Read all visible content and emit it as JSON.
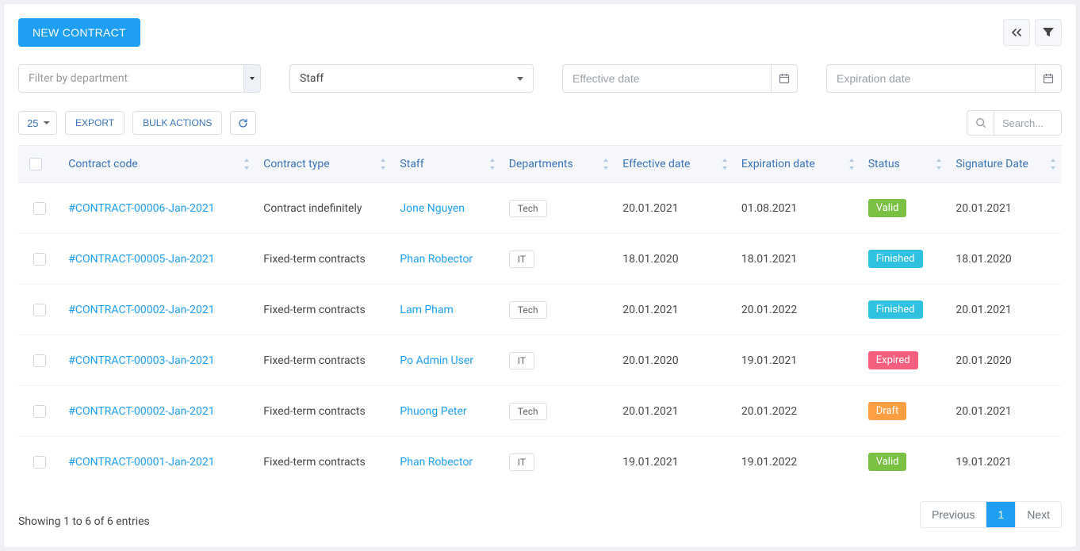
{
  "colors": {
    "primary": "#1e9ff2",
    "valid": "#7ac143",
    "finished": "#2fc1e0",
    "expired": "#f65f7e",
    "draft": "#ff9f43"
  },
  "topbar": {
    "new_contract_label": "NEW CONTRACT"
  },
  "filters": {
    "department_placeholder": "Filter by department",
    "staff_label": "Staff",
    "effective_placeholder": "Effective date",
    "expiration_placeholder": "Expiration date"
  },
  "toolbar": {
    "page_size": "25",
    "export_label": "EXPORT",
    "bulk_actions_label": "BULK ACTIONS",
    "search_placeholder": "Search..."
  },
  "table": {
    "headers": {
      "code": "Contract code",
      "type": "Contract type",
      "staff": "Staff",
      "dept": "Departments",
      "effective": "Effective date",
      "expiration": "Expiration date",
      "status": "Status",
      "signature": "Signature Date"
    },
    "rows": [
      {
        "code": "#CONTRACT-00006-Jan-2021",
        "type": "Contract indefinitely",
        "staff": "Jone Nguyen",
        "dept": "Tech",
        "effective": "20.01.2021",
        "expiration": "01.08.2021",
        "status": "Valid",
        "status_key": "valid",
        "signature": "20.01.2021"
      },
      {
        "code": "#CONTRACT-00005-Jan-2021",
        "type": "Fixed-term contracts",
        "staff": "Phan Robector",
        "dept": "IT",
        "effective": "18.01.2020",
        "expiration": "18.01.2021",
        "status": "Finished",
        "status_key": "finished",
        "signature": "18.01.2020"
      },
      {
        "code": "#CONTRACT-00002-Jan-2021",
        "type": "Fixed-term contracts",
        "staff": "Lam Pham",
        "dept": "Tech",
        "effective": "20.01.2021",
        "expiration": "20.01.2022",
        "status": "Finished",
        "status_key": "finished",
        "signature": "20.01.2021"
      },
      {
        "code": "#CONTRACT-00003-Jan-2021",
        "type": "Fixed-term contracts",
        "staff": "Po Admin User",
        "dept": "IT",
        "effective": "20.01.2020",
        "expiration": "19.01.2021",
        "status": "Expired",
        "status_key": "expired",
        "signature": "20.01.2020"
      },
      {
        "code": "#CONTRACT-00002-Jan-2021",
        "type": "Fixed-term contracts",
        "staff": "Phuong Peter",
        "dept": "Tech",
        "effective": "20.01.2021",
        "expiration": "20.01.2022",
        "status": "Draft",
        "status_key": "draft",
        "signature": "20.01.2021"
      },
      {
        "code": "#CONTRACT-00001-Jan-2021",
        "type": "Fixed-term contracts",
        "staff": "Phan Robector",
        "dept": "IT",
        "effective": "19.01.2021",
        "expiration": "19.01.2022",
        "status": "Valid",
        "status_key": "valid",
        "signature": "19.01.2021"
      }
    ]
  },
  "footer": {
    "entries_info": "Showing 1 to 6 of 6 entries",
    "prev_label": "Previous",
    "next_label": "Next",
    "current_page": "1"
  }
}
